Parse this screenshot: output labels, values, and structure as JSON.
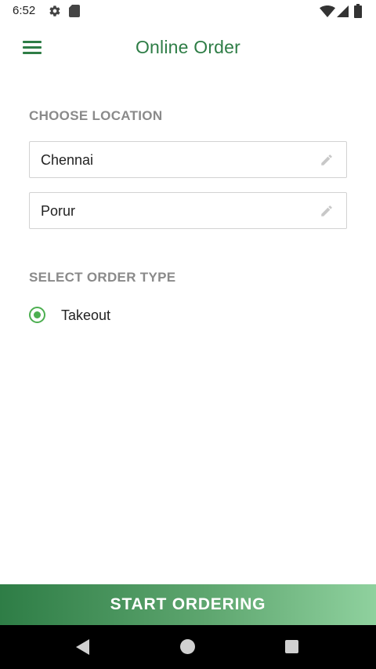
{
  "status_bar": {
    "time": "6:52",
    "icons": [
      "gear-icon",
      "sd-card-icon",
      "wifi-icon",
      "cell-signal-icon",
      "battery-icon"
    ]
  },
  "app_bar": {
    "title": "Online Order",
    "menu_icon": "hamburger-menu-icon"
  },
  "location": {
    "section_label": "CHOOSE LOCATION",
    "city": "Chennai",
    "area": "Porur",
    "edit_icon": "pencil-icon"
  },
  "order_type": {
    "section_label": "SELECT ORDER TYPE",
    "options": [
      {
        "label": "Takeout",
        "selected": true
      }
    ]
  },
  "start_button": {
    "label": "START ORDERING"
  },
  "nav_bar": {
    "icons": [
      "back-icon",
      "home-icon",
      "recents-icon"
    ]
  },
  "colors": {
    "primary_green": "#2e7d46",
    "radio_green": "#4caf50",
    "label_gray": "#8a8a8a",
    "border_gray": "#d2d2d2",
    "button_gradient_start": "#2e7d46",
    "button_gradient_end": "#8fd19e"
  }
}
